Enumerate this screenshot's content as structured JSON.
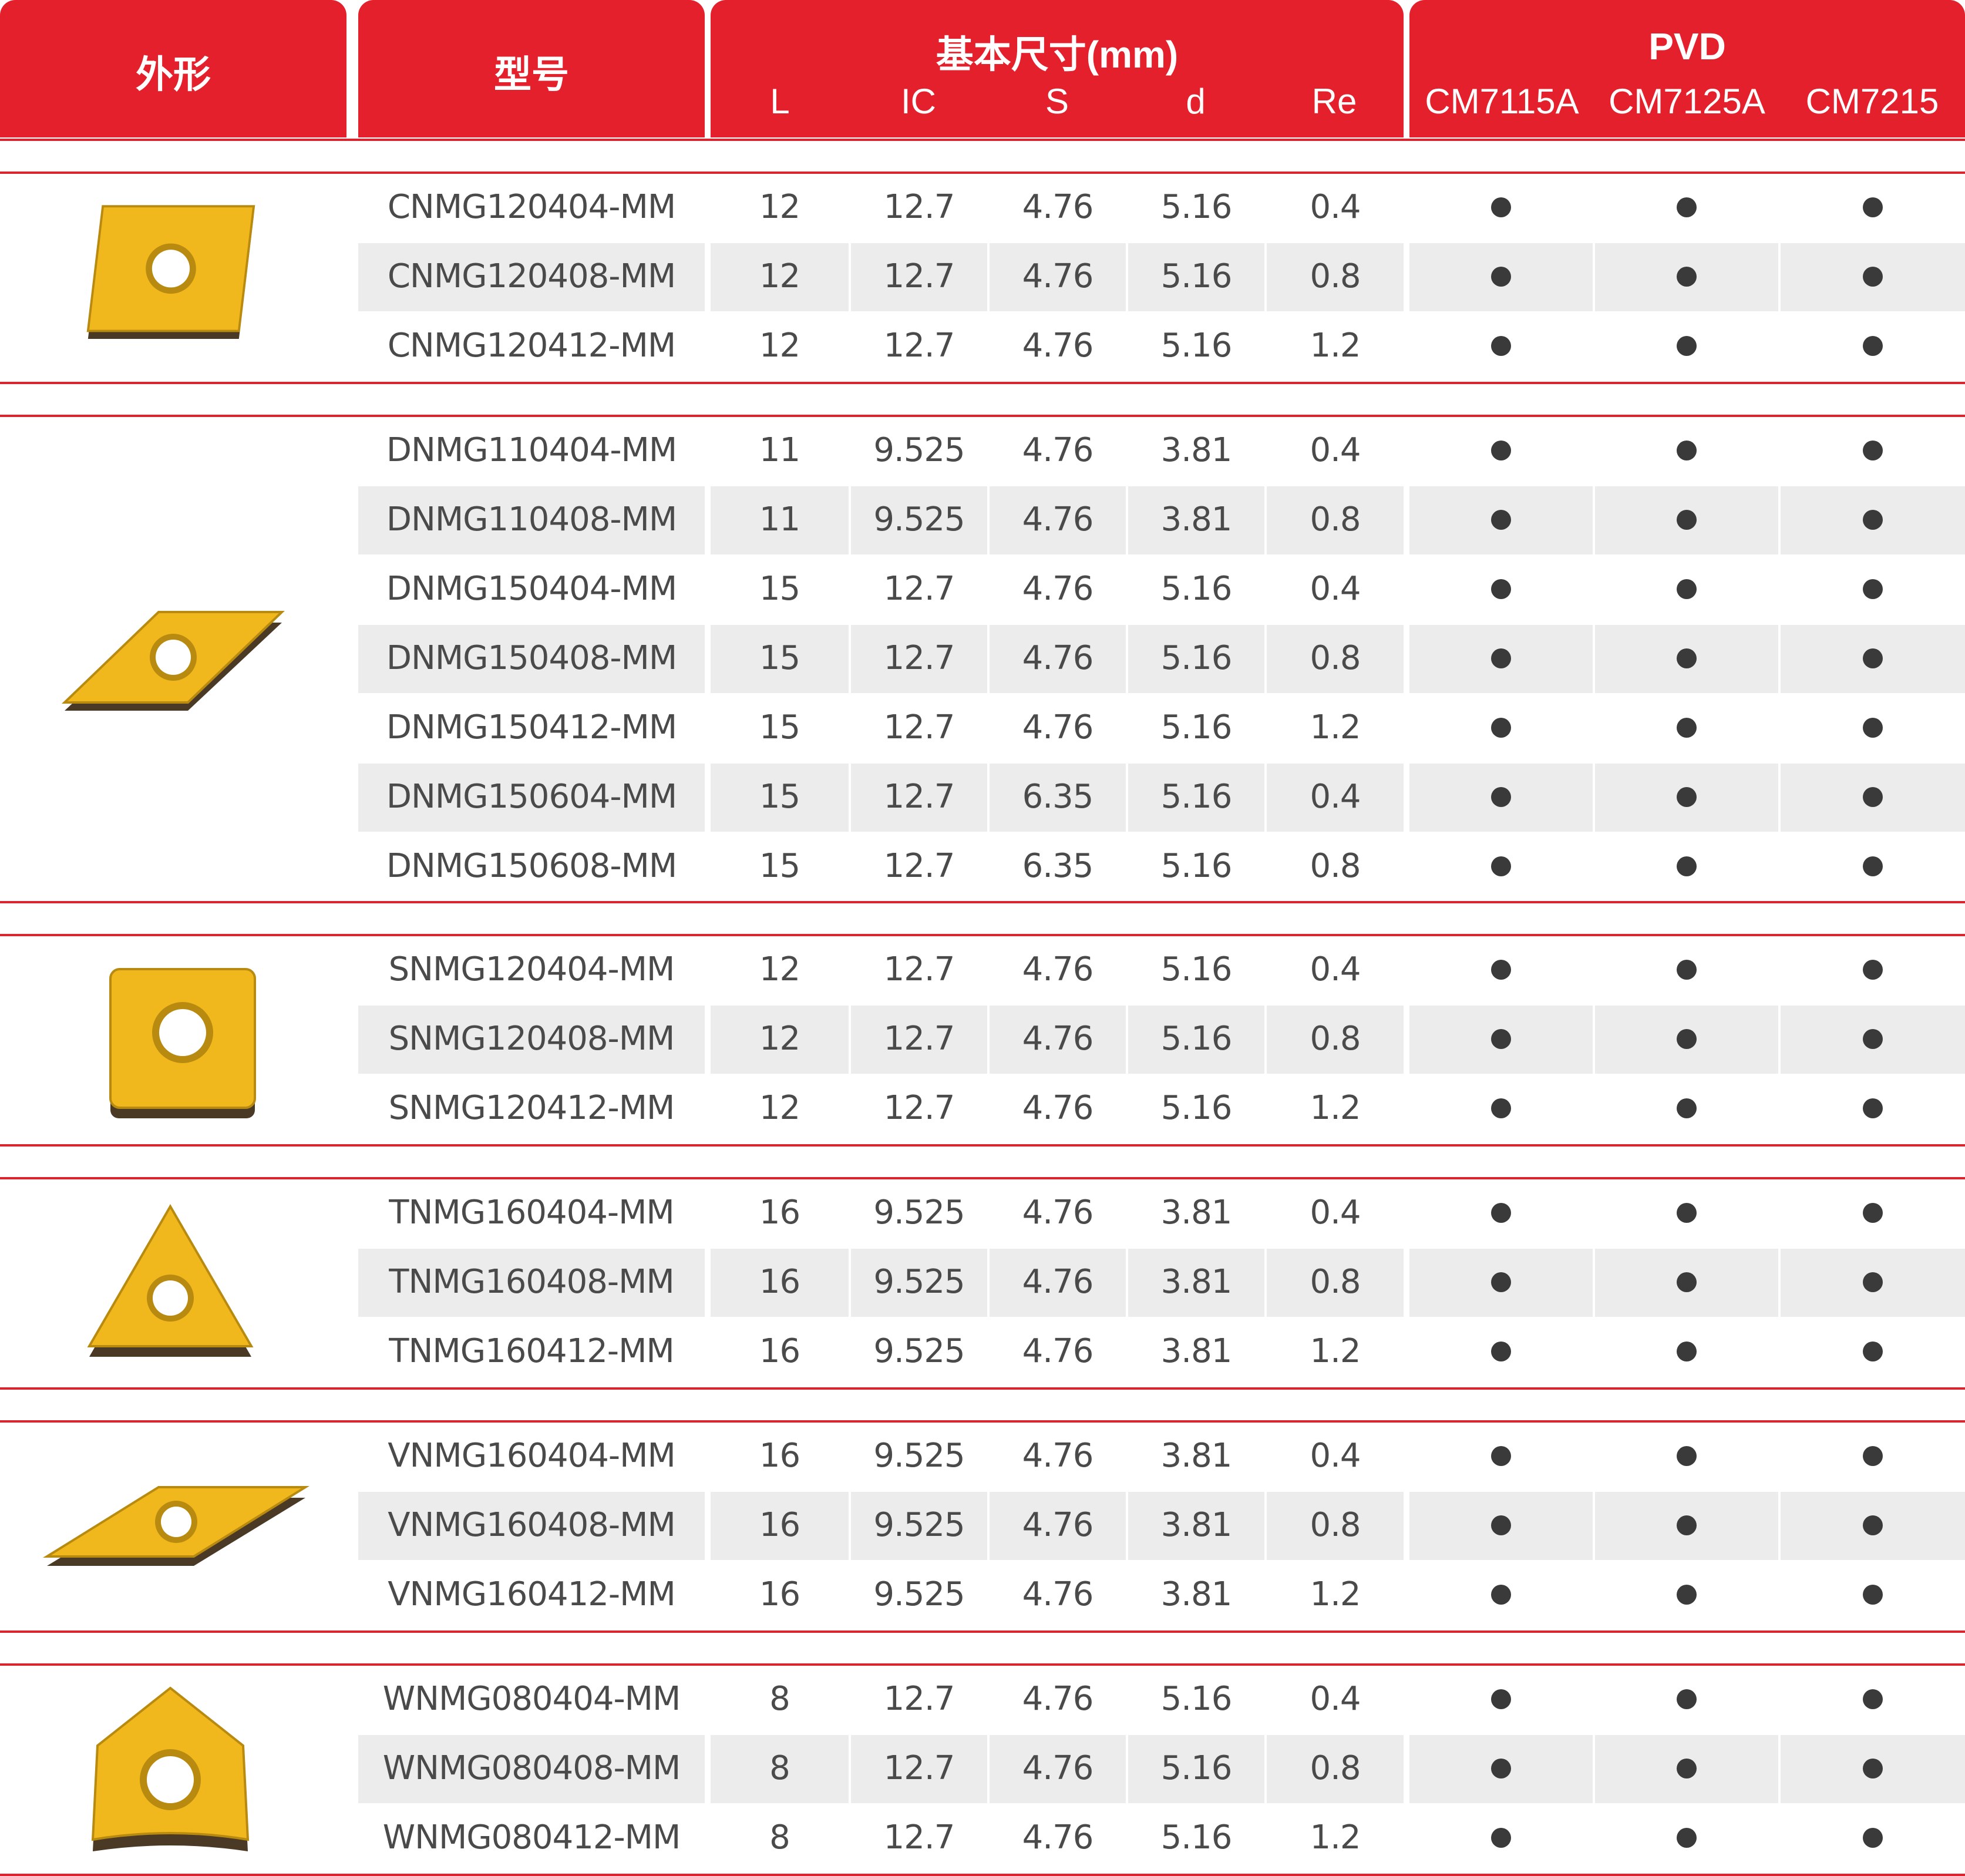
{
  "header": {
    "shape_label": "外形",
    "model_label": "型号",
    "dims_title": "基本尺寸(mm)",
    "dims_cols": [
      "L",
      "IC",
      "S",
      "d",
      "Re"
    ],
    "pvd_title": "PVD",
    "pvd_cols": [
      "CM7115A",
      "CM7125A",
      "CM7215"
    ]
  },
  "colors": {
    "header_red": "#e4202c",
    "insert_gold": "#f1b81d",
    "row_stripe": "#ececec",
    "dot": "#3a3a3a"
  },
  "groups": [
    {
      "shape_icon": "cnmg-rhombus-80-insert-icon",
      "rows": [
        {
          "model": "CNMG120404-MM",
          "L": "12",
          "IC": "12.7",
          "S": "4.76",
          "d": "5.16",
          "Re": "0.4",
          "grades": [
            true,
            true,
            true
          ]
        },
        {
          "model": "CNMG120408-MM",
          "L": "12",
          "IC": "12.7",
          "S": "4.76",
          "d": "5.16",
          "Re": "0.8",
          "grades": [
            true,
            true,
            true
          ]
        },
        {
          "model": "CNMG120412-MM",
          "L": "12",
          "IC": "12.7",
          "S": "4.76",
          "d": "5.16",
          "Re": "1.2",
          "grades": [
            true,
            true,
            true
          ]
        }
      ]
    },
    {
      "shape_icon": "dnmg-rhombus-55-insert-icon",
      "rows": [
        {
          "model": "DNMG110404-MM",
          "L": "11",
          "IC": "9.525",
          "S": "4.76",
          "d": "3.81",
          "Re": "0.4",
          "grades": [
            true,
            true,
            true
          ]
        },
        {
          "model": "DNMG110408-MM",
          "L": "11",
          "IC": "9.525",
          "S": "4.76",
          "d": "3.81",
          "Re": "0.8",
          "grades": [
            true,
            true,
            true
          ]
        },
        {
          "model": "DNMG150404-MM",
          "L": "15",
          "IC": "12.7",
          "S": "4.76",
          "d": "5.16",
          "Re": "0.4",
          "grades": [
            true,
            true,
            true
          ]
        },
        {
          "model": "DNMG150408-MM",
          "L": "15",
          "IC": "12.7",
          "S": "4.76",
          "d": "5.16",
          "Re": "0.8",
          "grades": [
            true,
            true,
            true
          ]
        },
        {
          "model": "DNMG150412-MM",
          "L": "15",
          "IC": "12.7",
          "S": "4.76",
          "d": "5.16",
          "Re": "1.2",
          "grades": [
            true,
            true,
            true
          ]
        },
        {
          "model": "DNMG150604-MM",
          "L": "15",
          "IC": "12.7",
          "S": "6.35",
          "d": "5.16",
          "Re": "0.4",
          "grades": [
            true,
            true,
            true
          ]
        },
        {
          "model": "DNMG150608-MM",
          "L": "15",
          "IC": "12.7",
          "S": "6.35",
          "d": "5.16",
          "Re": "0.8",
          "grades": [
            true,
            true,
            true
          ]
        }
      ]
    },
    {
      "shape_icon": "snmg-square-insert-icon",
      "rows": [
        {
          "model": "SNMG120404-MM",
          "L": "12",
          "IC": "12.7",
          "S": "4.76",
          "d": "5.16",
          "Re": "0.4",
          "grades": [
            true,
            true,
            true
          ]
        },
        {
          "model": "SNMG120408-MM",
          "L": "12",
          "IC": "12.7",
          "S": "4.76",
          "d": "5.16",
          "Re": "0.8",
          "grades": [
            true,
            true,
            true
          ]
        },
        {
          "model": "SNMG120412-MM",
          "L": "12",
          "IC": "12.7",
          "S": "4.76",
          "d": "5.16",
          "Re": "1.2",
          "grades": [
            true,
            true,
            true
          ]
        }
      ]
    },
    {
      "shape_icon": "tnmg-triangle-insert-icon",
      "rows": [
        {
          "model": "TNMG160404-MM",
          "L": "16",
          "IC": "9.525",
          "S": "4.76",
          "d": "3.81",
          "Re": "0.4",
          "grades": [
            true,
            true,
            true
          ]
        },
        {
          "model": "TNMG160408-MM",
          "L": "16",
          "IC": "9.525",
          "S": "4.76",
          "d": "3.81",
          "Re": "0.8",
          "grades": [
            true,
            true,
            true
          ]
        },
        {
          "model": "TNMG160412-MM",
          "L": "16",
          "IC": "9.525",
          "S": "4.76",
          "d": "3.81",
          "Re": "1.2",
          "grades": [
            true,
            true,
            true
          ]
        }
      ]
    },
    {
      "shape_icon": "vnmg-rhombus-35-insert-icon",
      "rows": [
        {
          "model": "VNMG160404-MM",
          "L": "16",
          "IC": "9.525",
          "S": "4.76",
          "d": "3.81",
          "Re": "0.4",
          "grades": [
            true,
            true,
            true
          ]
        },
        {
          "model": "VNMG160408-MM",
          "L": "16",
          "IC": "9.525",
          "S": "4.76",
          "d": "3.81",
          "Re": "0.8",
          "grades": [
            true,
            true,
            true
          ]
        },
        {
          "model": "VNMG160412-MM",
          "L": "16",
          "IC": "9.525",
          "S": "4.76",
          "d": "3.81",
          "Re": "1.2",
          "grades": [
            true,
            true,
            true
          ]
        }
      ]
    },
    {
      "shape_icon": "wnmg-trigon-insert-icon",
      "rows": [
        {
          "model": "WNMG080404-MM",
          "L": "8",
          "IC": "12.7",
          "S": "4.76",
          "d": "5.16",
          "Re": "0.4",
          "grades": [
            true,
            true,
            true
          ]
        },
        {
          "model": "WNMG080408-MM",
          "L": "8",
          "IC": "12.7",
          "S": "4.76",
          "d": "5.16",
          "Re": "0.8",
          "grades": [
            true,
            true,
            true
          ]
        },
        {
          "model": "WNMG080412-MM",
          "L": "8",
          "IC": "12.7",
          "S": "4.76",
          "d": "5.16",
          "Re": "1.2",
          "grades": [
            true,
            true,
            true
          ]
        }
      ]
    }
  ]
}
